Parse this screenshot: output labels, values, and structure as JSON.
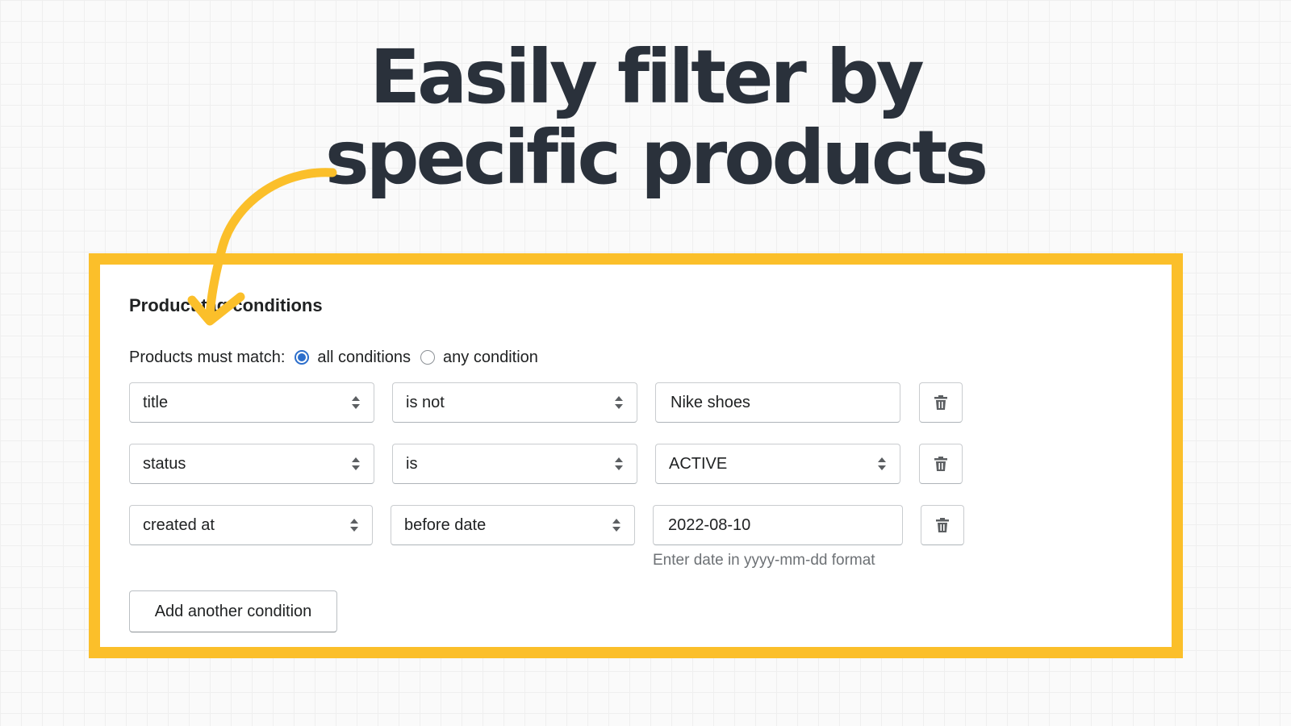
{
  "headline": {
    "line1": "Easily filter by",
    "line2": "specific products"
  },
  "colors": {
    "accent_frame": "#fbbf2a",
    "arrow": "#fbbf2a",
    "radio_selected": "#2c6ecb",
    "text_dark": "#202223",
    "help_text": "#6d7175"
  },
  "panel": {
    "title": "Product tag conditions",
    "match_label": "Products must match:",
    "options": [
      {
        "label": "all conditions",
        "selected": true
      },
      {
        "label": "any condition",
        "selected": false
      }
    ]
  },
  "conditions": [
    {
      "field": "title",
      "operator": "is not",
      "value": "Nike shoes",
      "value_type": "text"
    },
    {
      "field": "status",
      "operator": "is",
      "value": "ACTIVE",
      "value_type": "select"
    },
    {
      "field": "created at",
      "operator": "before date",
      "value": "2022-08-10",
      "value_type": "text"
    }
  ],
  "date_help_text": "Enter date in yyyy-mm-dd format",
  "add_button_label": "Add another condition",
  "icons": {
    "select": "chevron-up-down-icon",
    "delete": "trash-icon",
    "annotation": "curved-arrow-icon"
  }
}
